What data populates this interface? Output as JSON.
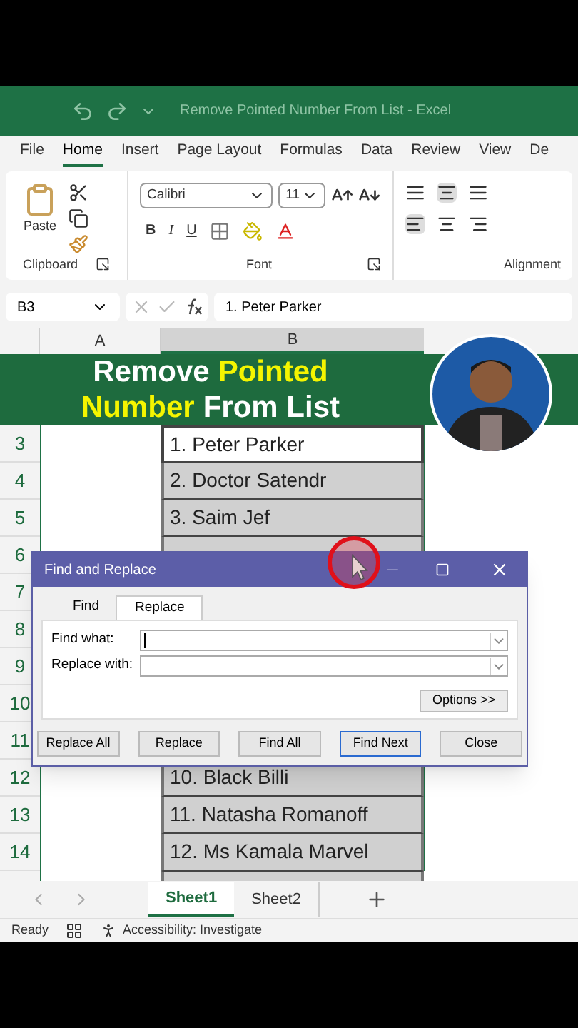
{
  "window": {
    "title": "Remove Pointed Number From List  -  Excel"
  },
  "ribbon_tabs": [
    {
      "label": "File",
      "selected": false
    },
    {
      "label": "Home",
      "selected": true
    },
    {
      "label": "Insert",
      "selected": false
    },
    {
      "label": "Page Layout",
      "selected": false
    },
    {
      "label": "Formulas",
      "selected": false
    },
    {
      "label": "Data",
      "selected": false
    },
    {
      "label": "Review",
      "selected": false
    },
    {
      "label": "View",
      "selected": false
    },
    {
      "label": "De",
      "selected": false
    }
  ],
  "ribbon": {
    "paste_label": "Paste",
    "font_name": "Calibri",
    "font_size": "11",
    "format_buttons": [
      "B",
      "I",
      "U"
    ],
    "groups": [
      "Clipboard",
      "Font",
      "Alignment"
    ]
  },
  "formula_bar": {
    "name_box": "B3",
    "value": "1. Peter Parker"
  },
  "columns": [
    "A",
    "B"
  ],
  "banner": {
    "lines": [
      [
        {
          "text": "Remove",
          "highlight": false
        },
        {
          "text": "Pointed",
          "highlight": true
        }
      ],
      [
        {
          "text": "Number",
          "highlight": true
        },
        {
          "text": "From List",
          "highlight": false
        }
      ]
    ]
  },
  "rows": [
    {
      "number": "3",
      "cell_b": "1. Peter Parker",
      "selected": true
    },
    {
      "number": "4",
      "cell_b": "2. Doctor Satendr",
      "selected": false
    },
    {
      "number": "5",
      "cell_b": "3. Saim Jef",
      "selected": false
    },
    {
      "number": "6"
    },
    {
      "number": "7"
    },
    {
      "number": "8"
    },
    {
      "number": "9"
    },
    {
      "number": "10"
    },
    {
      "number": "11"
    },
    {
      "number": "12",
      "cell_b": "10. Black Billi",
      "selected": false
    },
    {
      "number": "13",
      "cell_b": "11. Natasha Romanoff",
      "selected": false
    },
    {
      "number": "14",
      "cell_b": "12. Ms Kamala Marvel",
      "selected": false
    }
  ],
  "dialog": {
    "title": "Find and Replace",
    "tabs": [
      {
        "label": "Find",
        "selected": false
      },
      {
        "label": "Replace",
        "selected": true
      }
    ],
    "fields": [
      {
        "label": "Find what:",
        "focused": true
      },
      {
        "label": "Replace with:"
      }
    ],
    "options_button": "Options >>",
    "buttons": [
      {
        "label": "Replace All",
        "default": false
      },
      {
        "label": "Replace",
        "default": false
      },
      {
        "label": "Find All",
        "default": false
      },
      {
        "label": "Find Next",
        "default": true
      },
      {
        "label": "Close",
        "default": false
      }
    ]
  },
  "sheet_tabs": [
    {
      "label": "Sheet1",
      "selected": true
    },
    {
      "label": "Sheet2",
      "selected": false
    }
  ],
  "status_bar": {
    "ready": "Ready",
    "accessibility": "Accessibility: Investigate"
  }
}
